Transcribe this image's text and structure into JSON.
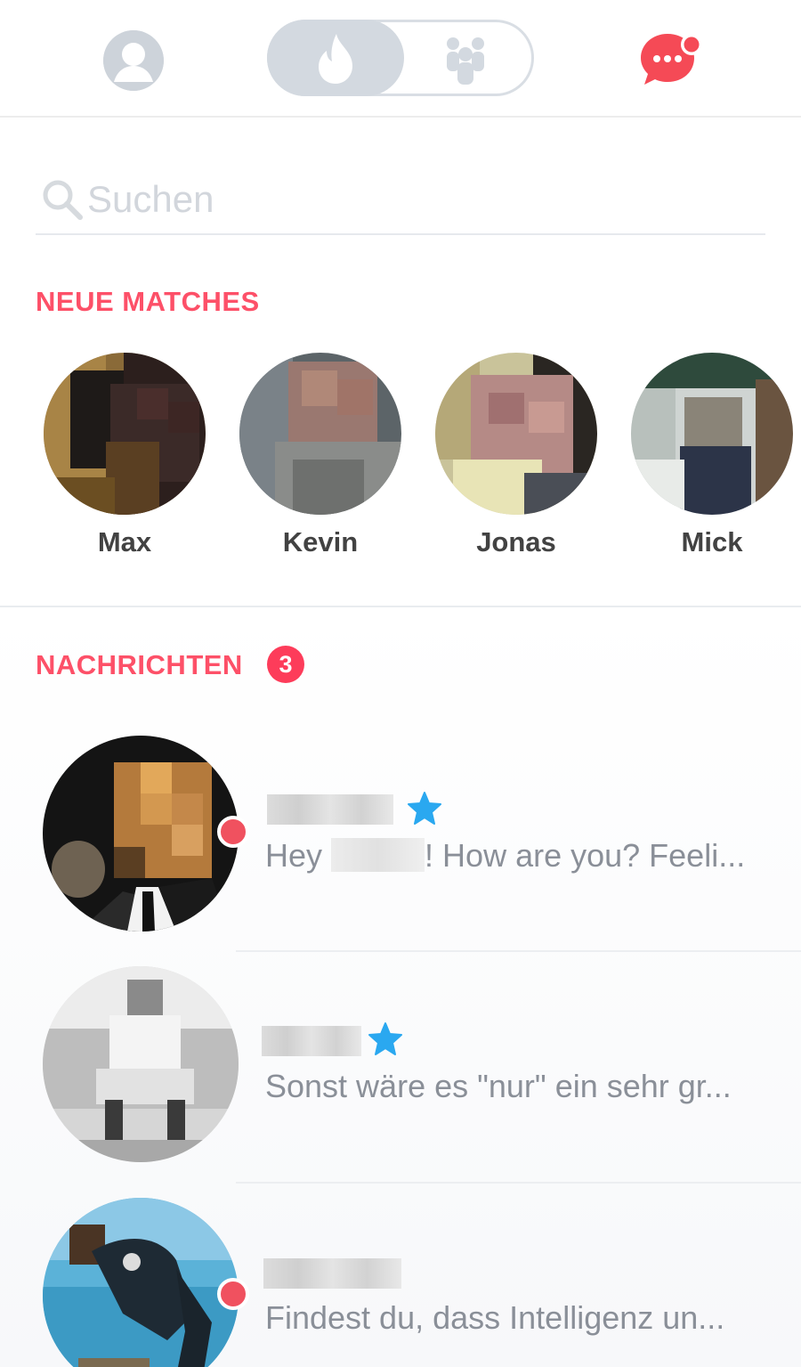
{
  "topbar": {
    "profile_icon": "profile-icon",
    "mode_toggle": {
      "active": "flame-icon",
      "inactive": "social-icon"
    },
    "chat_icon": "chat-icon",
    "accent_color": "#fd5068"
  },
  "search": {
    "placeholder": "Suchen",
    "value": ""
  },
  "new_matches": {
    "title": "NEUE MATCHES",
    "items": [
      {
        "name": "Max"
      },
      {
        "name": "Kevin"
      },
      {
        "name": "Jonas"
      },
      {
        "name": "Mick"
      }
    ]
  },
  "messages": {
    "title": "NACHRICHTEN",
    "count": "3",
    "items": [
      {
        "preview_start": "Hey",
        "preview_end": "! How are you? Feeli...",
        "unread": true,
        "starred": true
      },
      {
        "preview": "Sonst wäre es \"nur\" ein sehr gr...",
        "unread": false,
        "starred": true
      },
      {
        "preview": "Findest du, dass Intelligenz un...",
        "unread": true,
        "starred": false
      }
    ]
  },
  "colors": {
    "accent": "#fd5068",
    "badge": "#fd3c5a",
    "unread_dot": "#f0515f",
    "star": "#2aa8f0",
    "muted_text": "#8a8f98"
  }
}
